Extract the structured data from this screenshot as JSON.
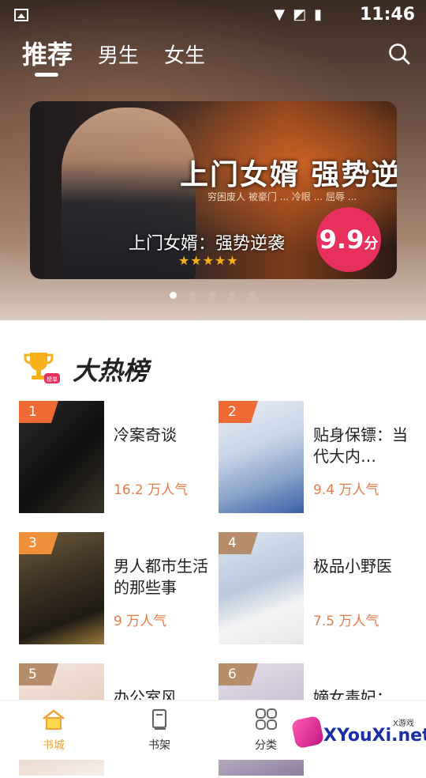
{
  "status_bar": {
    "time": "11:46"
  },
  "tabs": [
    {
      "label": "推荐",
      "active": true
    },
    {
      "label": "男生",
      "active": false
    },
    {
      "label": "女生",
      "active": false
    }
  ],
  "banner": {
    "headline": "上门女婿 强势逆",
    "subline": "穷困废人 被豪门 ... 冷眼 ... 屈辱 ...",
    "name": "上门女婿：强势逆袭",
    "stars": "★★★★★",
    "score_num": "9.9",
    "score_unit": "分",
    "dot_count": 5,
    "active_dot": 0
  },
  "section": {
    "title": "大热榜",
    "badge": "榜单"
  },
  "books": [
    {
      "rank": "1",
      "title": "冷案奇谈",
      "popularity": "16.2 万人气",
      "rank_color": "#f06a35"
    },
    {
      "rank": "2",
      "title": "贴身保镖：当代大内…",
      "popularity": "9.4 万人气",
      "rank_color": "#f06a35"
    },
    {
      "rank": "3",
      "title": "男人都市生活的那些事",
      "popularity": "9 万人气",
      "rank_color": "#f08f3a"
    },
    {
      "rank": "4",
      "title": "极品小野医",
      "popularity": "7.5 万人气",
      "rank_color": "#b58d6a"
    },
    {
      "rank": "5",
      "title": "办公室风",
      "popularity": "",
      "rank_color": "#b58d6a"
    },
    {
      "rank": "6",
      "title": "嫡女毒妃：",
      "popularity": "",
      "rank_color": "#b58d6a"
    }
  ],
  "nav": [
    {
      "label": "书城",
      "active": true
    },
    {
      "label": "书架",
      "active": false
    },
    {
      "label": "分类",
      "active": false
    }
  ],
  "watermark": {
    "text": "XYouXi.net",
    "small": "X游戏"
  }
}
